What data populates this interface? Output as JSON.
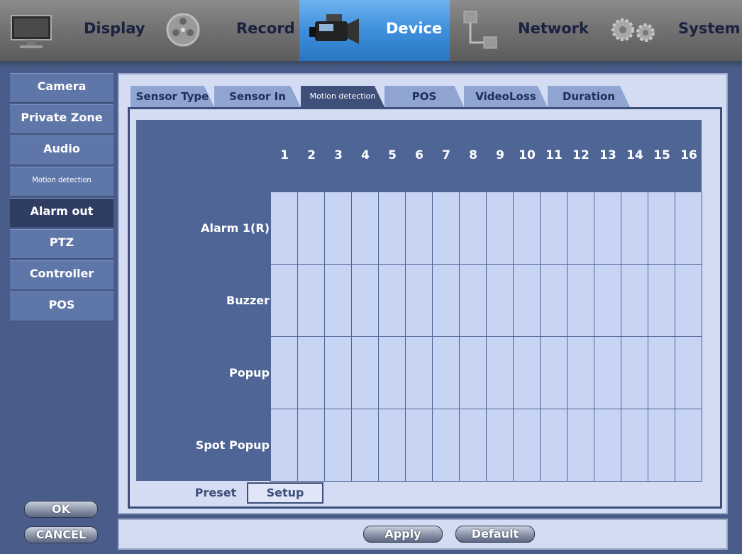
{
  "nav": {
    "items": [
      {
        "label": "Display",
        "icon": "monitor-icon",
        "active": false
      },
      {
        "label": "Record",
        "icon": "film-reel-icon",
        "active": false
      },
      {
        "label": "Device",
        "icon": "camcorder-icon",
        "active": true
      },
      {
        "label": "Network",
        "icon": "network-icon",
        "active": false
      },
      {
        "label": "System",
        "icon": "gears-icon",
        "active": false
      }
    ]
  },
  "sidebar": {
    "items": [
      {
        "label": "Camera"
      },
      {
        "label": "Private Zone"
      },
      {
        "label": "Audio"
      },
      {
        "label": "Motion detection"
      },
      {
        "label": "Alarm out"
      },
      {
        "label": "PTZ"
      },
      {
        "label": "Controller"
      },
      {
        "label": "POS"
      }
    ],
    "active": "Alarm out"
  },
  "tabs": [
    {
      "label": "Sensor Type"
    },
    {
      "label": "Sensor In"
    },
    {
      "label": "Motion detection"
    },
    {
      "label": "POS"
    },
    {
      "label": "VideoLoss"
    },
    {
      "label": "Duration"
    }
  ],
  "grid": {
    "columns": [
      "1",
      "2",
      "3",
      "4",
      "5",
      "6",
      "7",
      "8",
      "9",
      "10",
      "11",
      "12",
      "13",
      "14",
      "15",
      "16"
    ],
    "rows": [
      "Alarm 1(R)",
      "Buzzer",
      "Popup",
      "Spot Popup"
    ]
  },
  "subtabs": {
    "preset": "Preset",
    "setup": "Setup"
  },
  "buttons": {
    "ok": "OK",
    "cancel": "CANCEL",
    "apply": "Apply",
    "default": "Default"
  },
  "colors": {
    "active_nav": "#3d8fdc",
    "panel_bg": "#d4dcf4",
    "grid_header": "#4f6596",
    "cell": "#c8d4f4"
  }
}
